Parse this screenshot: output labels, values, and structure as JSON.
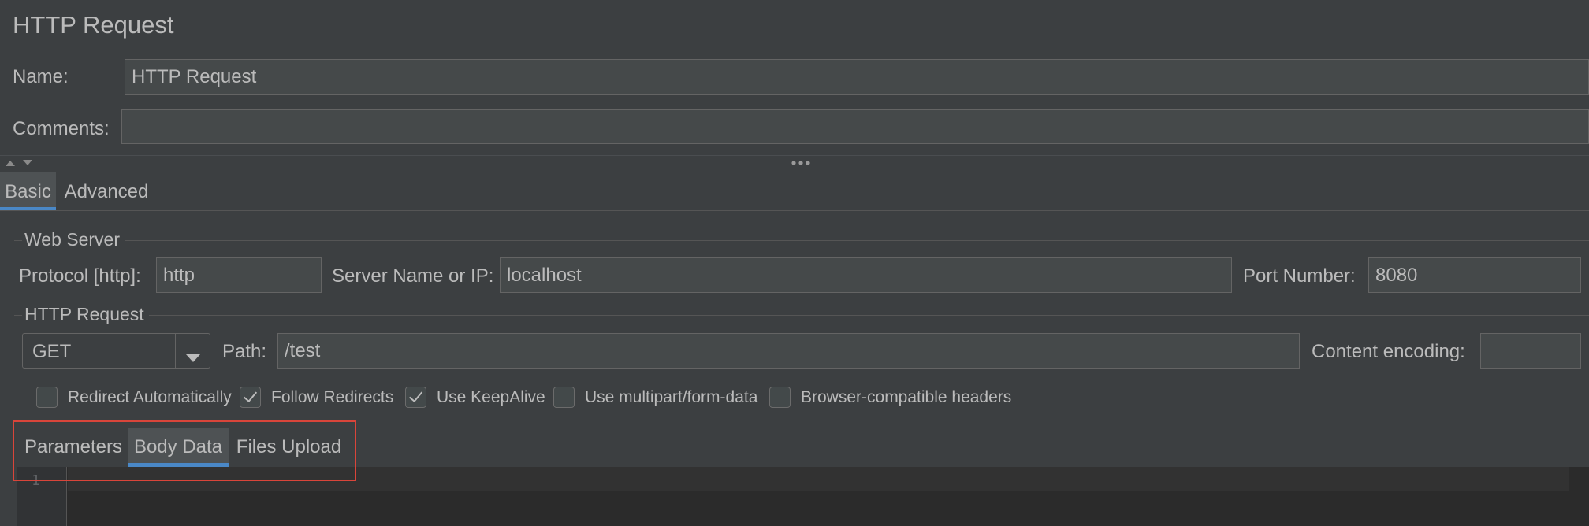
{
  "panel": {
    "title": "HTTP Request"
  },
  "name_field": {
    "label": "Name:",
    "value": "HTTP Request"
  },
  "comments_field": {
    "label": "Comments:",
    "value": ""
  },
  "main_tabs": [
    {
      "label": "Basic",
      "active": true
    },
    {
      "label": "Advanced",
      "active": false
    }
  ],
  "web_server": {
    "title": "Web Server",
    "protocol_label": "Protocol [http]:",
    "protocol_value": "http",
    "server_label": "Server Name or IP:",
    "server_value": "localhost",
    "port_label": "Port Number:",
    "port_value": "8080"
  },
  "http_request": {
    "title": "HTTP Request",
    "method": "GET",
    "path_label": "Path:",
    "path_value": "/test",
    "encoding_label": "Content encoding:",
    "encoding_value": ""
  },
  "options": [
    {
      "label": "Redirect Automatically",
      "checked": false
    },
    {
      "label": "Follow Redirects",
      "checked": true
    },
    {
      "label": "Use KeepAlive",
      "checked": true
    },
    {
      "label": "Use multipart/form-data",
      "checked": false
    },
    {
      "label": "Browser-compatible headers",
      "checked": false
    }
  ],
  "body_tabs": [
    {
      "label": "Parameters",
      "active": false
    },
    {
      "label": "Body Data",
      "active": true
    },
    {
      "label": "Files Upload",
      "active": false
    }
  ],
  "editor": {
    "line_number": "1"
  },
  "colors": {
    "accent": "#4a88c7",
    "highlight_box": "#d9453a",
    "background": "#3c3f41"
  }
}
